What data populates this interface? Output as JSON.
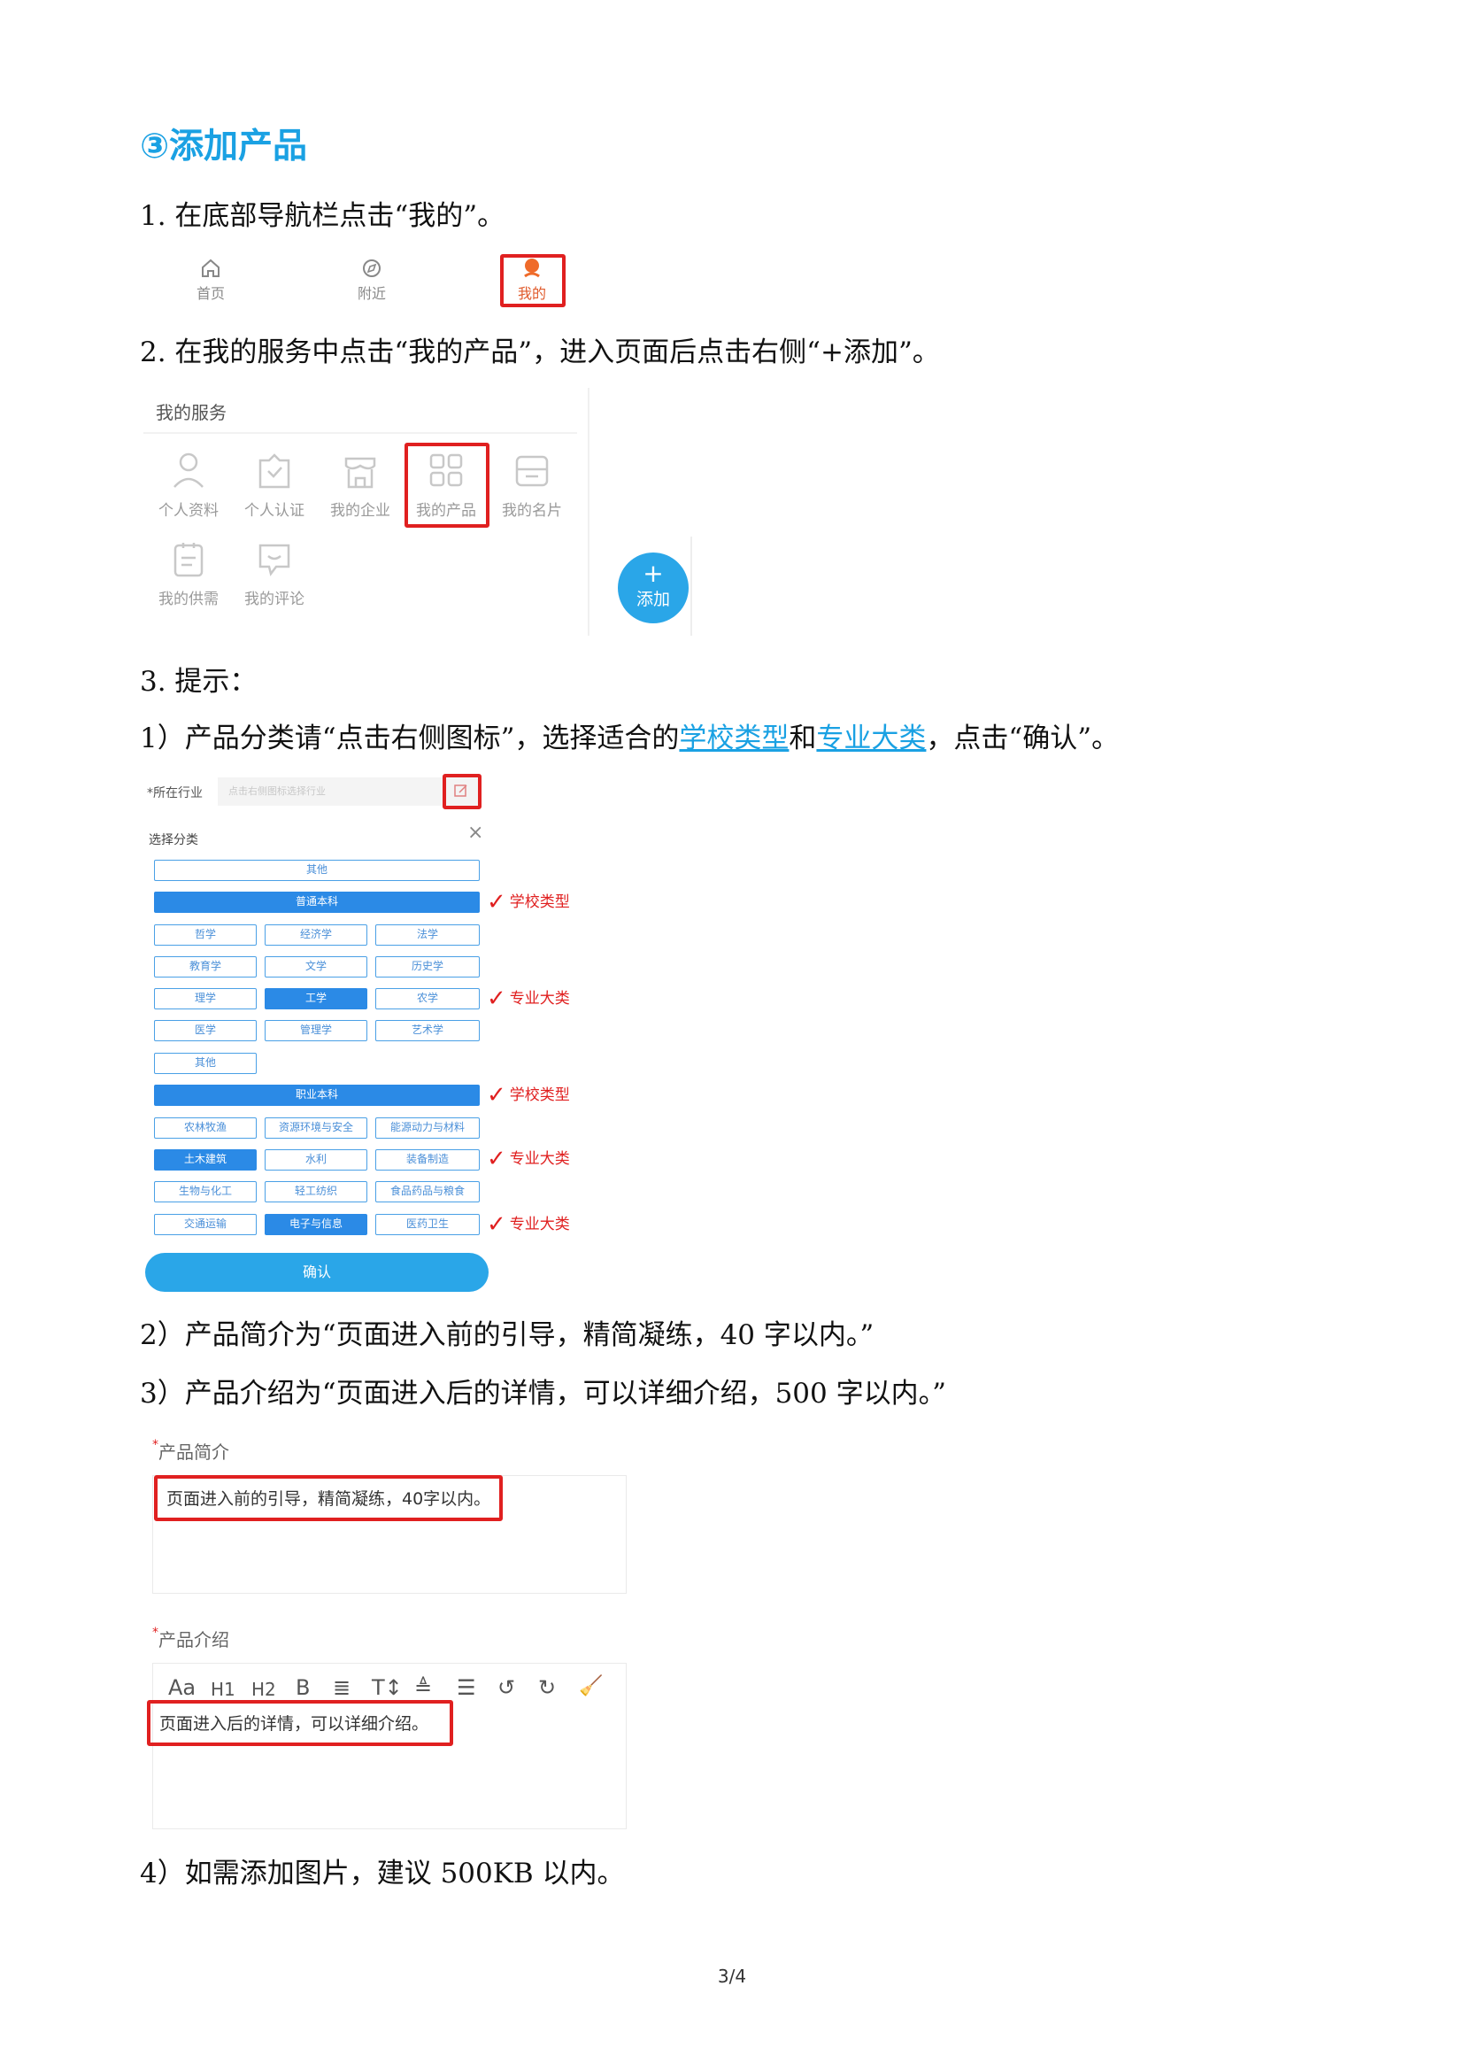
{
  "heading": "③添加产品",
  "step1": "1. 在底部导航栏点击“我的”。",
  "nav": {
    "home": "首页",
    "nearby": "附近",
    "mine": "我的"
  },
  "step2": "2. 在我的服务中点击“我的产品”，进入页面后点击右侧“+添加”。",
  "services": {
    "title": "我的服务",
    "items": [
      "个人资料",
      "个人认证",
      "我的企业",
      "我的产品",
      "我的名片",
      "我的供需",
      "我的评论"
    ]
  },
  "add_button": {
    "plus": "+",
    "label": "添加"
  },
  "step3": "3. 提示：",
  "tip1": {
    "pre": "1）产品分类请“点击右侧图标”，选择适合的",
    "link1": "学校类型",
    "mid": "和",
    "link2": "专业大类",
    "post": "，点击“确认”。"
  },
  "category_form": {
    "industry_label": "*所在行业",
    "industry_placeholder": "点击右侧图标选择行业",
    "dialog_title": "选择分类",
    "close": "×",
    "other_top": "其他",
    "general": "普通本科",
    "general_majors": [
      "哲学",
      "经济学",
      "法学",
      "教育学",
      "文学",
      "历史学",
      "理学",
      "工学",
      "农学",
      "医学",
      "管理学",
      "艺术学",
      "其他"
    ],
    "vocational": "职业本科",
    "vocational_majors": [
      "农林牧渔",
      "资源环境与安全",
      "能源动力与材料",
      "土木建筑",
      "水利",
      "装备制造",
      "生物与化工",
      "轻工纺织",
      "食品药品与粮食",
      "交通运输",
      "电子与信息",
      "医药卫生"
    ],
    "confirm": "确认"
  },
  "annotations": {
    "school_type": "学校类型",
    "major": "专业大类",
    "check": "✓"
  },
  "tip2": "2）产品简介为“页面进入前的引导，精简凝练，40 字以内。”",
  "tip3": "3）产品介绍为“页面进入后的详情，可以详细介绍，500 字以内。”",
  "intro": {
    "label": "产品简介",
    "star": "*",
    "text": "页面进入前的引导，精简凝练，40字以内。"
  },
  "detail": {
    "label": "产品介绍",
    "star": "*",
    "toolbar": [
      "Aa",
      "H1",
      "H2",
      "B",
      "≣",
      "T↕",
      "≜",
      "☰",
      "↺",
      "↻",
      "🧹"
    ],
    "text": "页面进入后的详情，可以详细介绍。"
  },
  "tip4": "4）如需添加图片，建议 500KB 以内。",
  "page_number": "3/4"
}
